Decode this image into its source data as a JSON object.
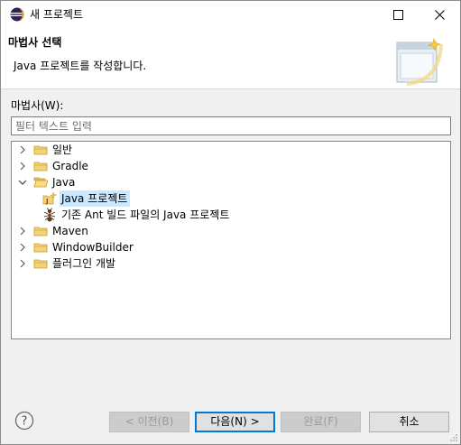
{
  "window": {
    "title": "새 프로젝트"
  },
  "banner": {
    "title": "마법사 선택",
    "description": "Java 프로젝트를 작성합니다."
  },
  "wizards": {
    "label": "마법사(W):",
    "filter_placeholder": "필터 텍스트 입력",
    "filter_value": ""
  },
  "tree": {
    "items": [
      {
        "label": "일반",
        "level": 0,
        "expanded": false,
        "icon": "folder-icon"
      },
      {
        "label": "Gradle",
        "level": 0,
        "expanded": false,
        "icon": "folder-icon"
      },
      {
        "label": "Java",
        "level": 0,
        "expanded": true,
        "icon": "open-folder-icon"
      },
      {
        "label": "Java 프로젝트",
        "level": 1,
        "selected": true,
        "icon": "java-project-wizard-icon"
      },
      {
        "label": "기존 Ant 빌드 파일의 Java 프로젝트",
        "level": 1,
        "icon": "ant-icon"
      },
      {
        "label": "Maven",
        "level": 0,
        "expanded": false,
        "icon": "folder-icon"
      },
      {
        "label": "WindowBuilder",
        "level": 0,
        "expanded": false,
        "icon": "folder-icon"
      },
      {
        "label": "플러그인 개발",
        "level": 0,
        "expanded": false,
        "icon": "folder-icon"
      }
    ]
  },
  "buttons": {
    "back": "< 이전(B)",
    "next": "다음(N) >",
    "finish": "완료(F)",
    "cancel": "취소"
  },
  "colors": {
    "selection": "#cce8ff",
    "default_button_border": "#0078d7",
    "folder": "#dcb067"
  }
}
